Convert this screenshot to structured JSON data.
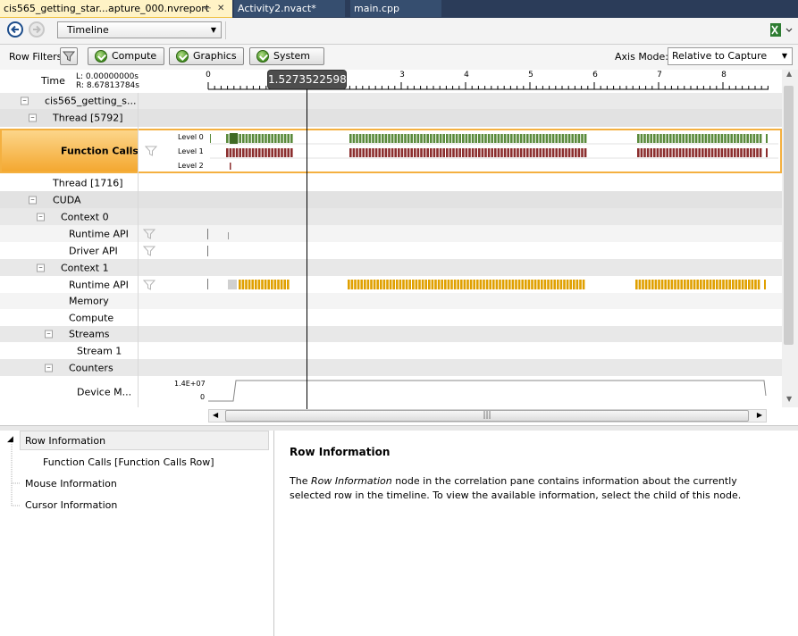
{
  "tabs": [
    {
      "label": "cis565_getting_star...apture_000.nvreport",
      "active": true
    },
    {
      "label": "Activity2.nvact*",
      "active": false
    },
    {
      "label": "main.cpp",
      "active": false
    }
  ],
  "toolbar": {
    "view_selected": "Timeline"
  },
  "filterbar": {
    "row_filters_label": "Row Filters",
    "buttons": [
      "Compute",
      "Graphics",
      "System"
    ],
    "axis_mode_label": "Axis Mode:",
    "axis_mode_value": "Relative to Capture"
  },
  "timeline": {
    "time_label": "Time",
    "time_left": "L: 0.00000000s",
    "time_right": "R: 8.67813784s",
    "ticks": [
      "0",
      "3",
      "4",
      "5",
      "6",
      "7",
      "8"
    ],
    "cursor_value": "1.5273522598"
  },
  "rows": {
    "report": "cis565_getting_s...",
    "thread1": "Thread [5792]",
    "function_calls": "Function Calls",
    "level0": "Level 0",
    "level1": "Level 1",
    "level2": "Level 2",
    "thread2": "Thread [1716]",
    "cuda": "CUDA",
    "context0": "Context 0",
    "runtime_api": "Runtime API",
    "driver_api": "Driver API",
    "context1": "Context 1",
    "memory": "Memory",
    "compute": "Compute",
    "streams": "Streams",
    "stream1": "Stream 1",
    "counters": "Counters",
    "device_m": "Device  M...",
    "counter_max": "1.4E+07",
    "counter_min": "0"
  },
  "colors": {
    "level0": "#5a8a3c",
    "level1": "#8b2e2e",
    "runtime": "#e0a000",
    "highlight": "#f8b850"
  },
  "tree": {
    "items": [
      "Row Information",
      "Function Calls [Function Calls Row]",
      "Mouse Information",
      "Cursor Information"
    ]
  },
  "detail": {
    "title": "Row Information",
    "body_italic": "Row Information",
    "body_before": "The ",
    "body_after": " node in the correlation pane contains information about the currently selected row in the timeline. To view the available information, select the child of this node."
  }
}
